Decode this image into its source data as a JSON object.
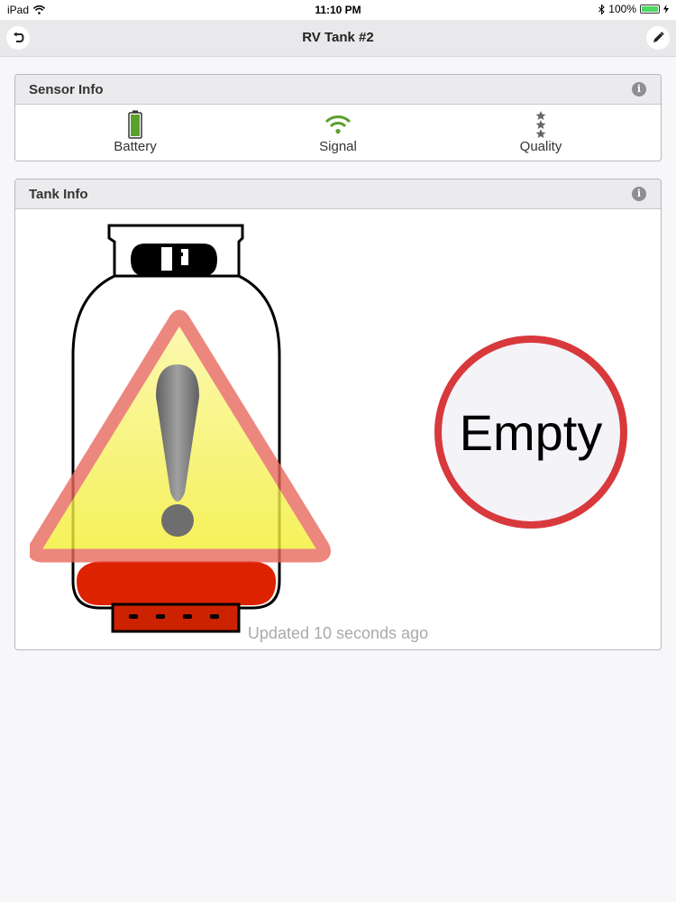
{
  "status_bar": {
    "device": "iPad",
    "time": "11:10 PM",
    "battery_percent": "100%",
    "icons": [
      "wifi-icon",
      "bluetooth-icon",
      "battery-icon",
      "charging-icon"
    ]
  },
  "nav": {
    "title": "RV Tank #2",
    "back_icon": "undo-arrow-icon",
    "edit_icon": "pencil-icon"
  },
  "sensor_info": {
    "title": "Sensor Info",
    "items": [
      {
        "label": "Battery",
        "icon": "battery-icon",
        "color": "#5aa02c"
      },
      {
        "label": "Signal",
        "icon": "wifi-signal-icon",
        "color": "#5aa02c"
      },
      {
        "label": "Quality",
        "icon": "stars-icon",
        "color": "#666666"
      }
    ]
  },
  "tank_info": {
    "title": "Tank Info",
    "level_text": "Empty",
    "updated_text": "Updated 10 seconds ago",
    "fill_level": 0.0,
    "colors": {
      "warning_border": "#e86a5e",
      "warning_fill": "#f5f04a",
      "liquid": "#dd2200",
      "gauge_ring": "#d8393c"
    }
  }
}
